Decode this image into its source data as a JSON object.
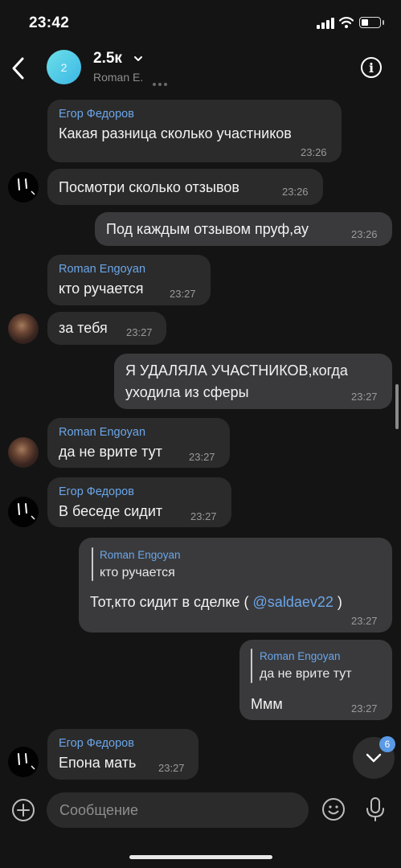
{
  "status_bar": {
    "time": "23:42"
  },
  "header": {
    "avatar_text": "2",
    "title": "2.5к",
    "subtitle": "Roman E."
  },
  "messages": [
    {
      "sender": "Егор Федоров",
      "text": "Какая разница сколько участников",
      "time": "23:26",
      "outgoing": false
    },
    {
      "text": "Посмотри сколько отзывов",
      "time": "23:26",
      "outgoing": false
    },
    {
      "text": "Под каждым отзывом пруф,ау",
      "time": "23:26",
      "outgoing": true
    },
    {
      "sender": "Roman Engoyan",
      "text": "кто ручается",
      "time": "23:27",
      "outgoing": false
    },
    {
      "text": "за тебя",
      "time": "23:27",
      "outgoing": false
    },
    {
      "text_line1": "Я УДАЛЯЛА УЧАСТНИКОВ,когда",
      "text_line2": "уходила из сферы",
      "time": "23:27",
      "outgoing": true
    },
    {
      "sender": "Roman Engoyan",
      "text": "да не врите тут",
      "time": "23:27",
      "outgoing": false
    },
    {
      "sender": "Егор Федоров",
      "text": "В беседе сидит",
      "time": "23:27",
      "outgoing": false
    },
    {
      "quote_name": "Roman Engoyan",
      "quote_text": "кто ручается",
      "text": "Тот,кто сидит в сделке (",
      "mention": "@saldaev22",
      "text_after": ")",
      "time": "23:27",
      "outgoing": true
    },
    {
      "quote_name": "Roman Engoyan",
      "quote_text": "да не врите тут",
      "text": "Ммм",
      "time": "23:27",
      "outgoing": true
    },
    {
      "sender": "Егор Федоров",
      "text": "Епона мать",
      "time": "23:27",
      "outgoing": false
    }
  ],
  "scroll_down": {
    "badge": "6"
  },
  "composer": {
    "placeholder": "Сообщение"
  },
  "colors": {
    "background": "#141414",
    "bubble_in": "#2b2b2b",
    "bubble_out": "#3a3a3c",
    "accent": "#6ba6e9"
  },
  "icons": [
    "back-icon",
    "chevron-down-icon",
    "info-icon",
    "add-icon",
    "emoji-icon",
    "mic-icon",
    "chevron-down-icon"
  ]
}
